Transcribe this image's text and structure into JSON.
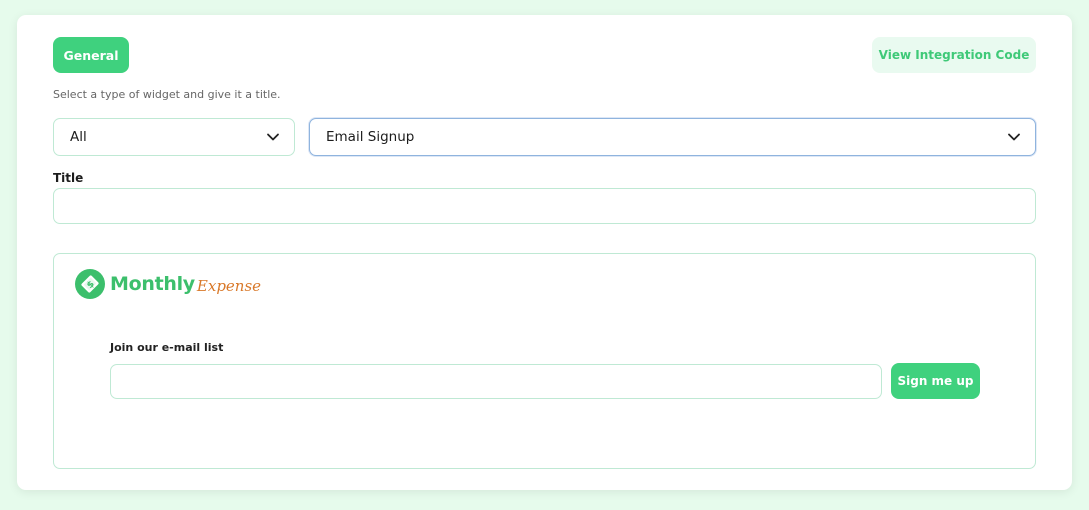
{
  "header": {
    "general_label": "General",
    "integration_label": "View Integration Code"
  },
  "form": {
    "hint": "Select a type of widget and give it a title.",
    "type_select_value": "All",
    "widget_select_value": "Email Signup",
    "title_label": "Title",
    "title_value": ""
  },
  "preview": {
    "logo_main": "Monthly",
    "logo_script": "Expense",
    "join_label": "Join our e-mail list",
    "email_value": "",
    "signup_label": "Sign me up"
  },
  "colors": {
    "accent": "#3fd17e",
    "accent_light": "#e9faf0",
    "border": "#bfe9d4",
    "logo_green": "#3cbf6c",
    "logo_orange": "#d9792a",
    "background": "#e6fbec"
  },
  "icons": {
    "select_chevron": "chevron-down-icon",
    "logo_mark": "dollar-bill-icon"
  }
}
